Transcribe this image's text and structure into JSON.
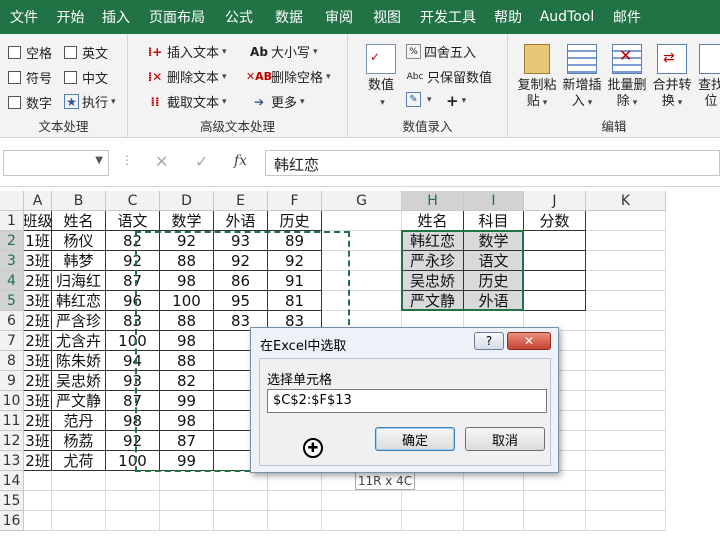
{
  "menu": [
    "文件",
    "开始",
    "插入",
    "页面布局",
    "公式",
    "数据",
    "审阅",
    "视图",
    "开发工具",
    "帮助",
    "AudTool",
    "邮件"
  ],
  "ribbon": {
    "text_group": {
      "label": "文本处理",
      "checkboxes": [
        "空格",
        "英文",
        "符号",
        "中文",
        "数字"
      ],
      "exec": "执行"
    },
    "adv_group": {
      "label": "高级文本处理",
      "buttons": [
        "插入文本",
        "删除文本",
        "截取文本",
        "大小写",
        "删除空格",
        "更多"
      ]
    },
    "num_group": {
      "label": "数值录入",
      "big": "数值",
      "buttons": [
        "四舍五入",
        "只保留数值"
      ],
      "plus": "+"
    },
    "edit_group": {
      "label": "编辑",
      "buttons": [
        [
          "复制粘",
          "贴"
        ],
        [
          "新增插",
          "入"
        ],
        [
          "批量删",
          "除"
        ],
        [
          "合并转",
          "换"
        ],
        [
          "查找",
          "位"
        ]
      ]
    }
  },
  "formula_bar": {
    "name_box": "",
    "cancel": "✕",
    "enter": "✓",
    "fx": "fx",
    "value": "韩红恋"
  },
  "sheet": {
    "columns": [
      "A",
      "B",
      "C",
      "D",
      "E",
      "F",
      "G",
      "H",
      "I",
      "J",
      "K"
    ],
    "rows": [
      "1",
      "2",
      "3",
      "4",
      "5",
      "6",
      "7",
      "8",
      "9",
      "10",
      "11",
      "12",
      "13",
      "14",
      "15",
      "16"
    ],
    "main_table": [
      [
        "班级",
        "姓名",
        "语文",
        "数学",
        "外语",
        "历史"
      ],
      [
        "1班",
        "杨仪",
        "82",
        "92",
        "93",
        "89"
      ],
      [
        "3班",
        "韩梦",
        "92",
        "88",
        "92",
        "92"
      ],
      [
        "2班",
        "归海红",
        "87",
        "98",
        "86",
        "91"
      ],
      [
        "3班",
        "韩红恋",
        "96",
        "100",
        "95",
        "81"
      ],
      [
        "2班",
        "严含珍",
        "83",
        "88",
        "83",
        "83"
      ],
      [
        "2班",
        "尤含卉",
        "100",
        "98",
        "",
        ""
      ],
      [
        "3班",
        "陈朱娇",
        "94",
        "88",
        "",
        ""
      ],
      [
        "2班",
        "吴忠娇",
        "93",
        "82",
        "",
        ""
      ],
      [
        "3班",
        "严文静",
        "87",
        "99",
        "",
        ""
      ],
      [
        "2班",
        "范丹",
        "98",
        "98",
        "",
        ""
      ],
      [
        "3班",
        "杨荔",
        "92",
        "87",
        "",
        ""
      ],
      [
        "2班",
        "尤荷",
        "100",
        "99",
        "",
        ""
      ]
    ],
    "lookup_table": [
      [
        "姓名",
        "科目",
        "分数"
      ],
      [
        "韩红恋",
        "数学",
        ""
      ],
      [
        "严永珍",
        "语文",
        ""
      ],
      [
        "吴忠娇",
        "历史",
        ""
      ],
      [
        "严文静",
        "外语",
        ""
      ]
    ],
    "size_tooltip": "11R x 4C"
  },
  "dialog": {
    "title": "在Excel中选取",
    "help": "?",
    "close": "✕",
    "prompt": "选择单元格",
    "input_value": "$C$2:$F$13",
    "ok": "确定",
    "cancel": "取消"
  },
  "colors": {
    "excel_green": "#217346",
    "selection_border": "#217346"
  }
}
